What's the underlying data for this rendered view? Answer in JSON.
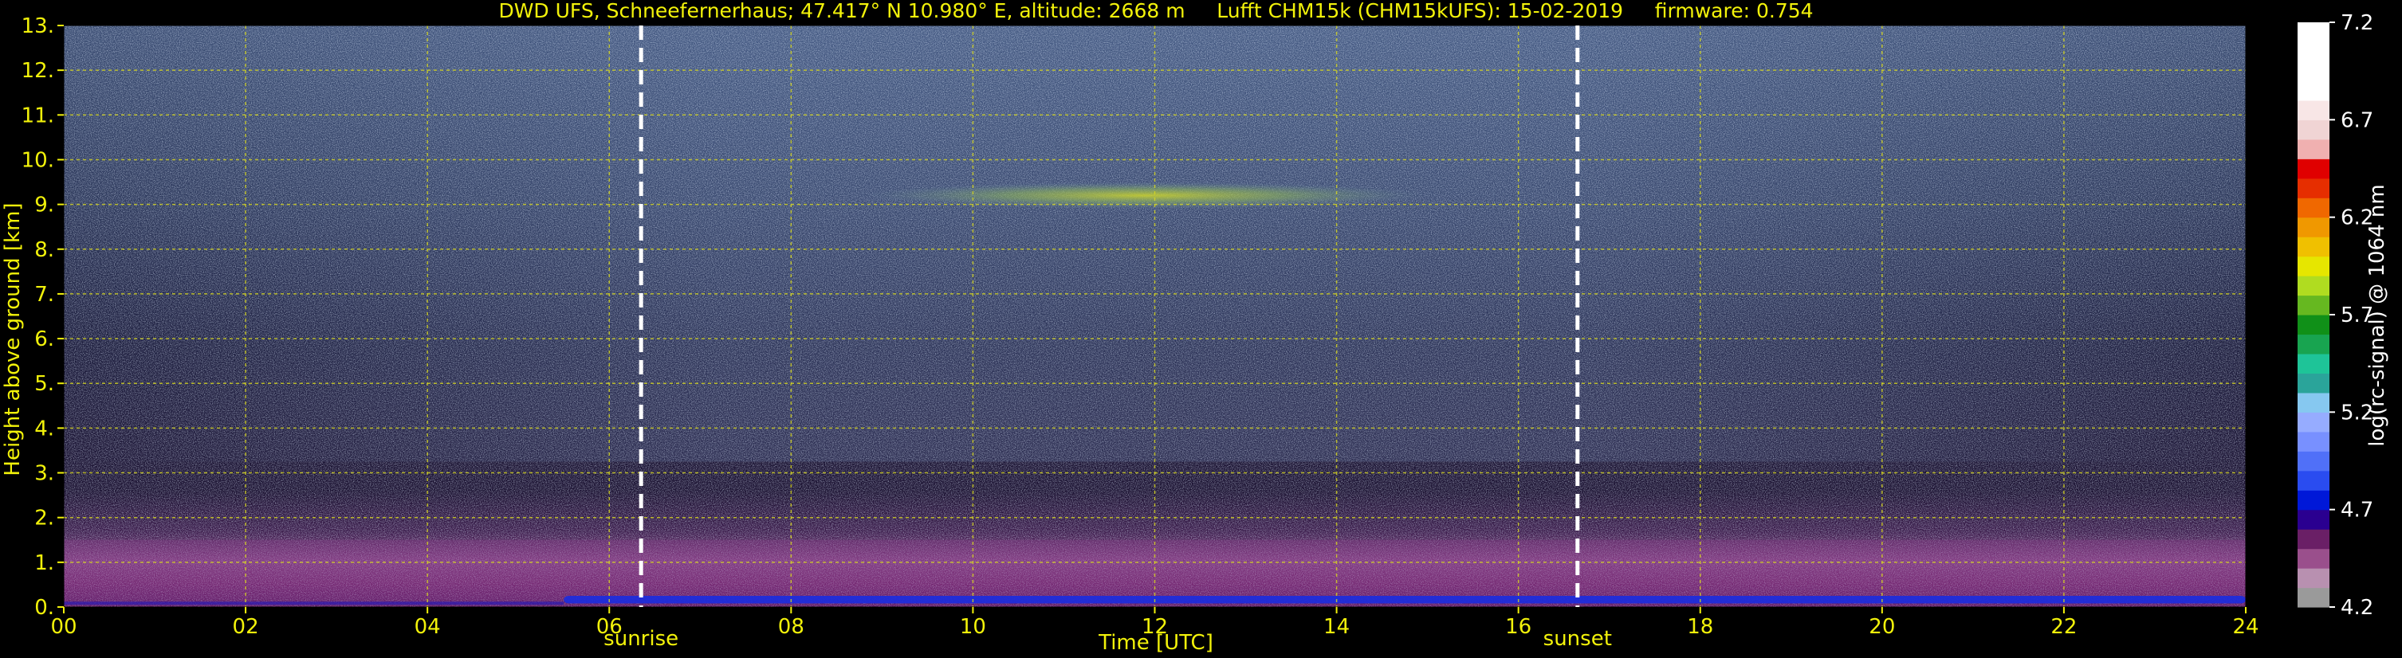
{
  "chart_data": {
    "type": "heatmap",
    "title": "DWD UFS, Schneefernerhaus; 47.417° N 10.980° E, altitude: 2668 m     Lufft CHM15k (CHM15kUFS): 15-02-2019     firmware: 0.754",
    "xlabel": "Time [UTC]",
    "ylabel": "Height above ground [km]",
    "x_ticks": [
      "00",
      "02",
      "04",
      "06",
      "08",
      "10",
      "12",
      "14",
      "16",
      "18",
      "20",
      "22",
      "24"
    ],
    "y_ticks": [
      "0.",
      "1.",
      "2.",
      "3.",
      "4.",
      "5.",
      "6.",
      "7.",
      "8.",
      "9.",
      "10.",
      "11.",
      "12.",
      "13."
    ],
    "xlim": [
      0,
      24
    ],
    "ylim": [
      0,
      13
    ],
    "grid": true,
    "colorbar": {
      "label": "log(rc-signal) @ 1064 nm",
      "ticks": [
        "4.2",
        "4.7",
        "5.2",
        "5.7",
        "6.2",
        "6.7",
        "7.2"
      ],
      "range": [
        4.2,
        7.2
      ],
      "colors": [
        "#9a9a9a",
        "#b890b0",
        "#9a4f8c",
        "#6a1f66",
        "#2a0090",
        "#0018d8",
        "#2a4cf0",
        "#5070f8",
        "#7890ff",
        "#96acff",
        "#86c8f0",
        "#2aa49a",
        "#1ec498",
        "#18a450",
        "#109018",
        "#66b820",
        "#b0dc20",
        "#e6e600",
        "#f0c000",
        "#f09800",
        "#f06800",
        "#e62e00",
        "#e00000",
        "#f0b0b0",
        "#f0d4d4",
        "#f8e6e6",
        "#ffffff",
        "#ffffff",
        "#ffffff",
        "#ffffff"
      ]
    },
    "events": [
      {
        "label": "sunrise",
        "time": 6.35
      },
      {
        "label": "sunset",
        "time": 16.65
      }
    ],
    "features": {
      "cirrus_layer": {
        "time_start": 8.8,
        "time_end": 15.0,
        "height_bottom": 8.9,
        "height_top": 9.5
      },
      "boundary_layer": {
        "time_start": 0,
        "time_end": 24,
        "height_top": 1.5
      },
      "low_signal_band": {
        "time_start": 5.5,
        "time_end": 24,
        "height_top": 0.25
      }
    }
  }
}
